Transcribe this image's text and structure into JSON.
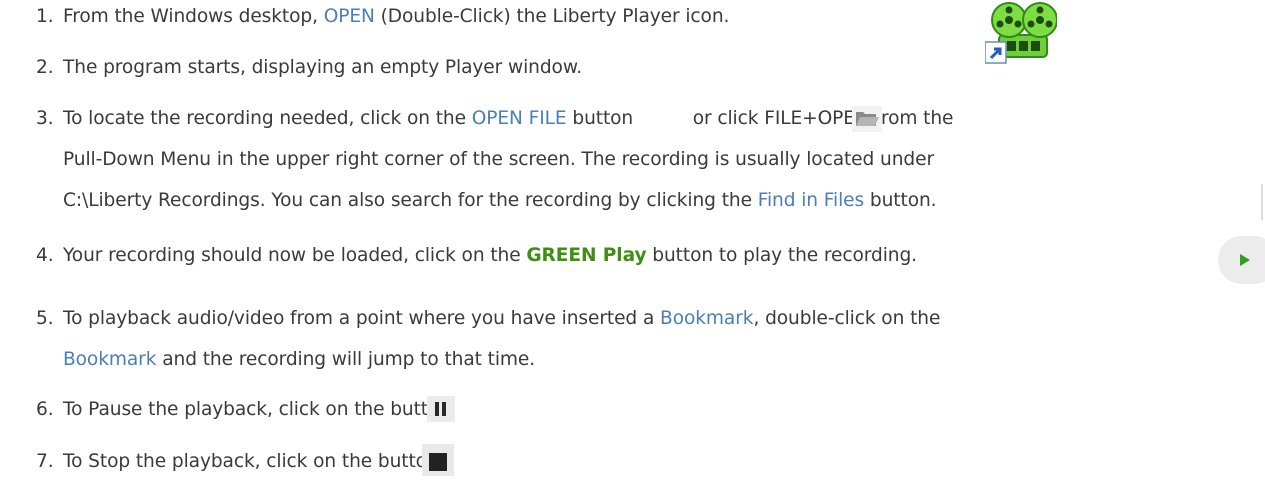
{
  "steps": [
    {
      "num": "1.",
      "t1": "From the Windows desktop,",
      "link1": "OPEN",
      "t2": "(Double-Click) the Liberty Player icon."
    },
    {
      "num": "2.",
      "t1": "The program starts, displaying an empty Player window."
    },
    {
      "num": "3.",
      "t1": "To locate the recording needed, click on the",
      "link1": "OPEN FILE",
      "t2": "button",
      "t3": "or click FILE+OPEN from the",
      "cont1": "Pull-Down Menu in the upper right corner of the screen. The recording is usually located under",
      "cont2a": "C:\\Liberty Recordings. You can also search for the recording by clicking the",
      "link2": "Find in Files",
      "cont2b": "button."
    },
    {
      "num": "4.",
      "t1": "Your recording should now be loaded, click on the",
      "highlight": "GREEN Play",
      "t2": "button to play the recording."
    },
    {
      "num": "5.",
      "t1": "To playback audio/video from a point where you have inserted a",
      "link1": "Bookmark",
      "t2": ", double-click on the",
      "cont_link": "Bookmark",
      "cont_text": "and the recording will jump to that time."
    },
    {
      "num": "6.",
      "t1": "To Pause the playback, click on the button."
    },
    {
      "num": "7.",
      "t1": "To Stop the playback, click on the button."
    }
  ],
  "icons": {
    "liberty_player": "liberty-player-reel-icon",
    "open_file": "folder-open-icon",
    "play": "play-icon",
    "pause": "pause-icon",
    "stop": "stop-icon"
  },
  "colors": {
    "text": "#3a3a3a",
    "link": "#4a7fb5",
    "green": "#3f8f12"
  }
}
